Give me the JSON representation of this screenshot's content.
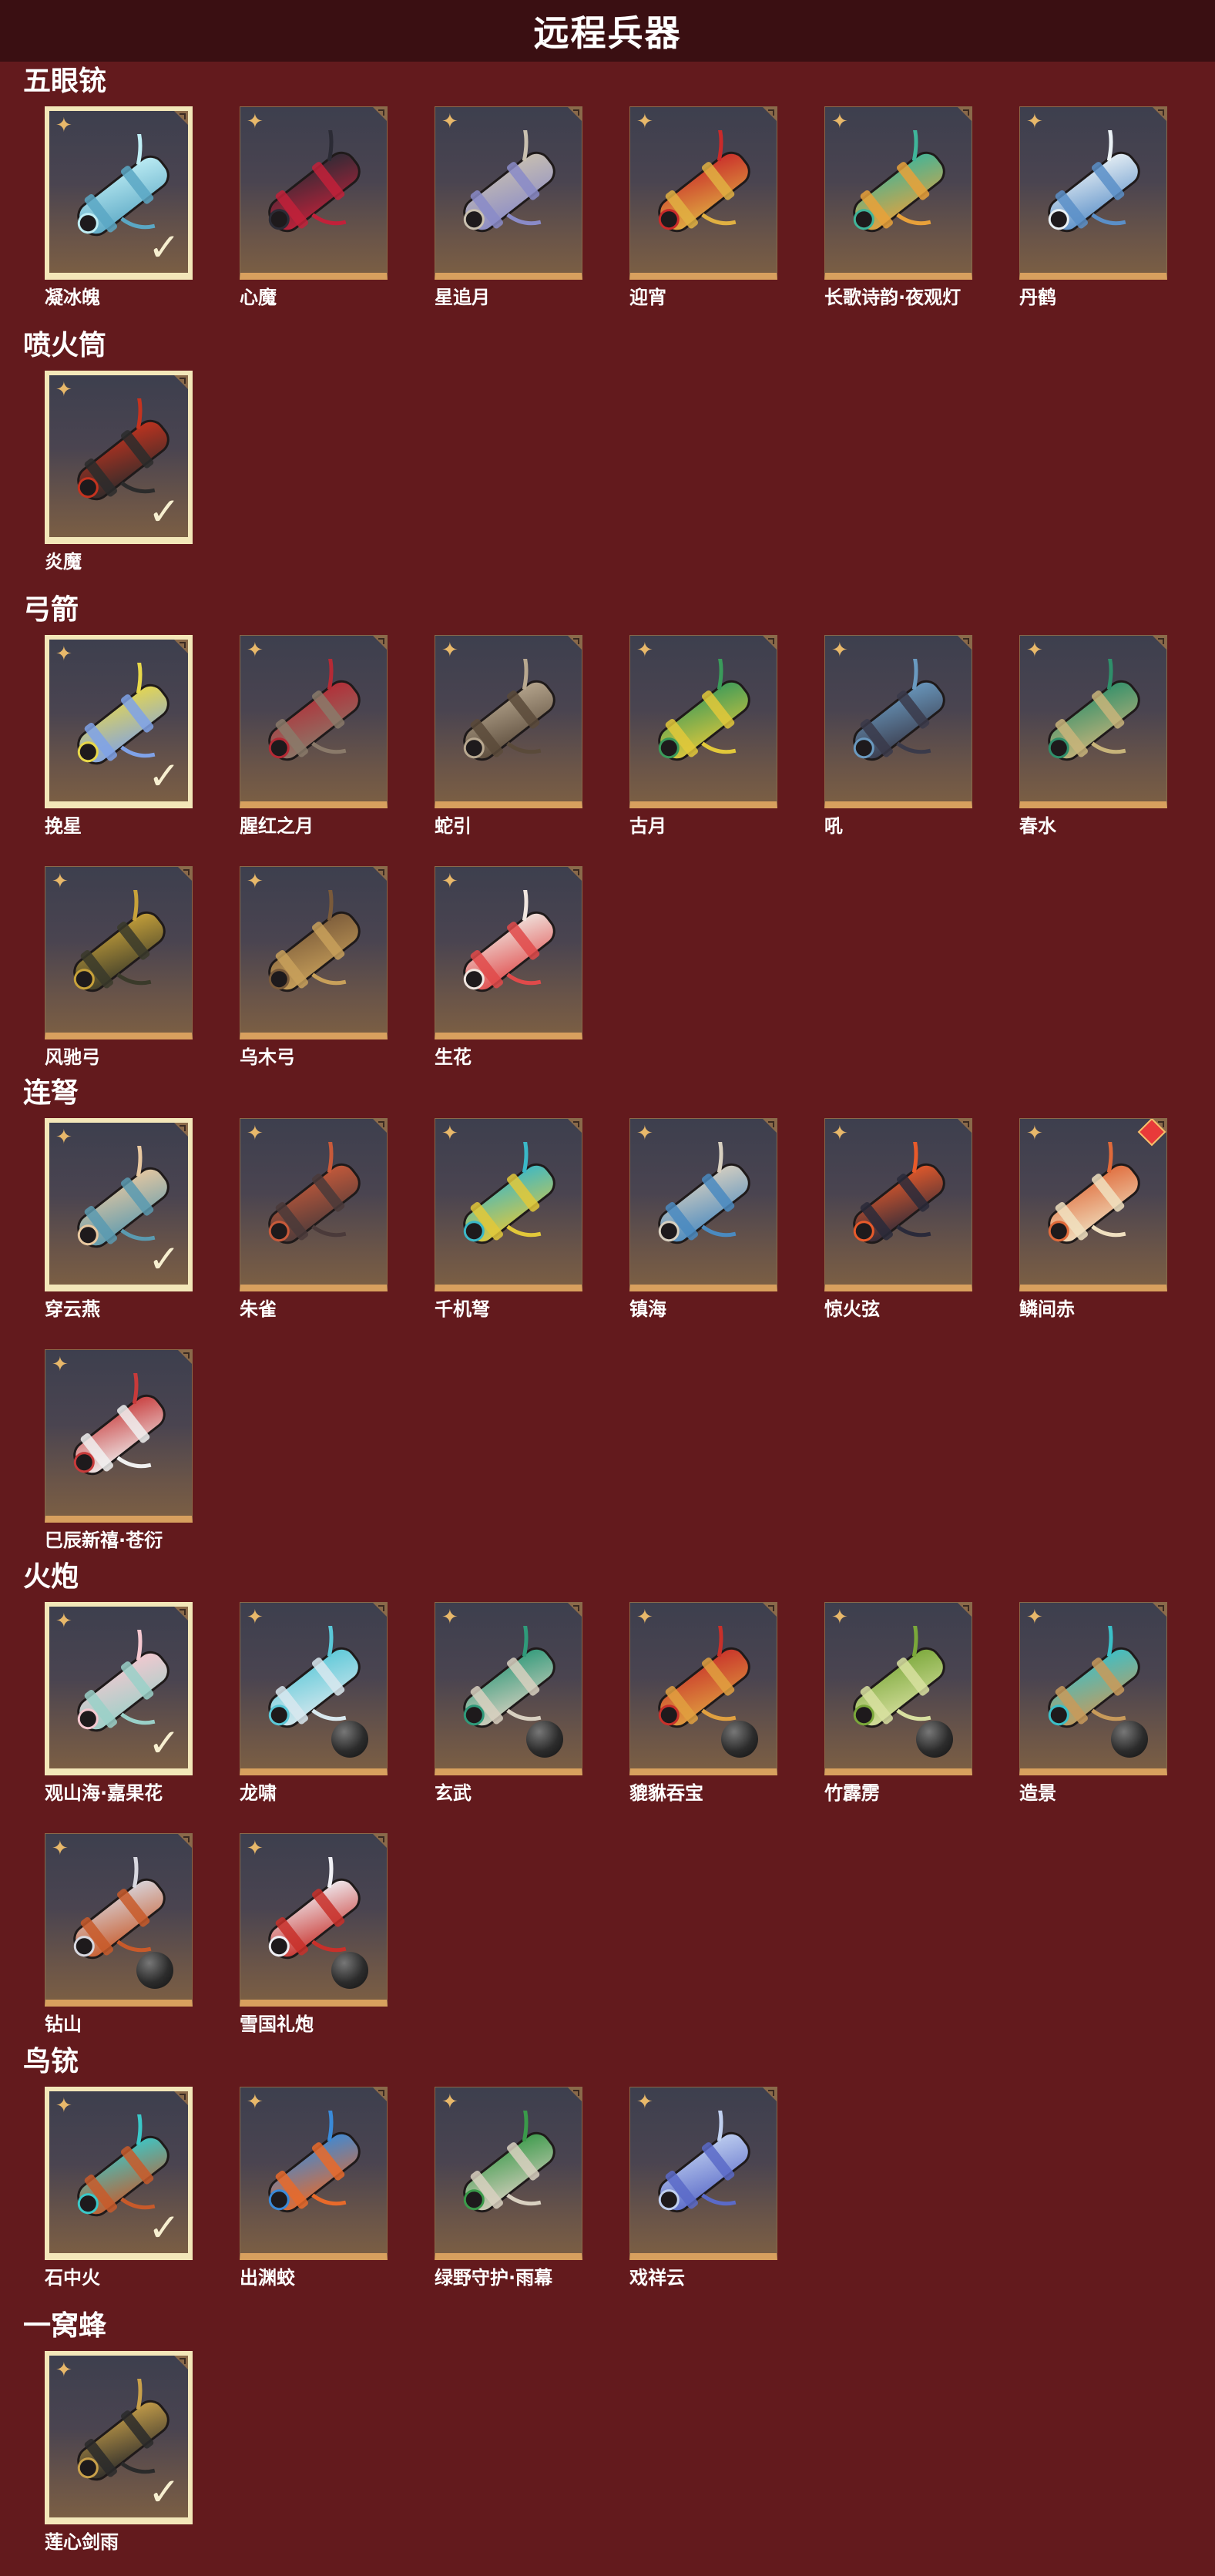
{
  "page": {
    "title": "远程兵器"
  },
  "colors": {
    "background": "#631a1d",
    "header": "#3a0f12",
    "card_bottom": "#d8a05e",
    "selected_border": "#f3e7b9"
  },
  "sections": [
    {
      "title": "五眼铳",
      "items": [
        {
          "name": "凝冰魄",
          "selected": true,
          "badge": "check",
          "palette": [
            "#bfeef5",
            "#5aa7c4"
          ]
        },
        {
          "name": "心魔",
          "selected": false,
          "badge": "none",
          "palette": [
            "#2b2b35",
            "#c2213a"
          ]
        },
        {
          "name": "星追月",
          "selected": false,
          "badge": "none",
          "palette": [
            "#c9c0b0",
            "#8a8bc8"
          ]
        },
        {
          "name": "迎宵",
          "selected": false,
          "badge": "none",
          "palette": [
            "#c92a2a",
            "#e0b042"
          ]
        },
        {
          "name": "长歌诗韵·夜观灯",
          "selected": false,
          "badge": "none",
          "palette": [
            "#3fb59a",
            "#e8a13a"
          ]
        },
        {
          "name": "丹鹤",
          "selected": false,
          "badge": "none",
          "palette": [
            "#eaf1f5",
            "#5a8fc8"
          ]
        }
      ]
    },
    {
      "title": "喷火筒",
      "items": [
        {
          "name": "炎魔",
          "selected": true,
          "badge": "check",
          "palette": [
            "#c4331f",
            "#2b2b2b"
          ]
        }
      ]
    },
    {
      "title": "弓箭",
      "items": [
        {
          "name": "挽星",
          "selected": true,
          "badge": "check",
          "palette": [
            "#e8d84a",
            "#7fa2e8"
          ]
        },
        {
          "name": "腥红之月",
          "selected": false,
          "badge": "none",
          "palette": [
            "#b52a35",
            "#8a7a6a"
          ]
        },
        {
          "name": "蛇引",
          "selected": false,
          "badge": "none",
          "palette": [
            "#b8a890",
            "#5a4a3a"
          ]
        },
        {
          "name": "古月",
          "selected": false,
          "badge": "none",
          "palette": [
            "#3a9a5a",
            "#e2c83a"
          ]
        },
        {
          "name": "吼",
          "selected": false,
          "badge": "none",
          "palette": [
            "#6a9ac0",
            "#3a3a4a"
          ]
        },
        {
          "name": "春水",
          "selected": false,
          "badge": "none",
          "palette": [
            "#2f8f6a",
            "#c8b47a"
          ]
        },
        {
          "name": "风驰弓",
          "selected": false,
          "badge": "none",
          "palette": [
            "#c8a23a",
            "#3a3a2a"
          ]
        },
        {
          "name": "乌木弓",
          "selected": false,
          "badge": "none",
          "palette": [
            "#7a5a3a",
            "#c8a05a"
          ]
        },
        {
          "name": "生花",
          "selected": false,
          "badge": "none",
          "palette": [
            "#f0e6e0",
            "#e04a4a"
          ]
        }
      ]
    },
    {
      "title": "连弩",
      "items": [
        {
          "name": "穿云燕",
          "selected": true,
          "badge": "check",
          "palette": [
            "#e8c8a0",
            "#5a9ab0"
          ]
        },
        {
          "name": "朱雀",
          "selected": false,
          "badge": "none",
          "palette": [
            "#c85a3a",
            "#4a3a3a"
          ]
        },
        {
          "name": "千机弩",
          "selected": false,
          "badge": "none",
          "palette": [
            "#3ab8c8",
            "#e2c83a"
          ]
        },
        {
          "name": "镇海",
          "selected": false,
          "badge": "none",
          "palette": [
            "#d8d0c0",
            "#4a8ac0"
          ]
        },
        {
          "name": "惊火弦",
          "selected": false,
          "badge": "none",
          "palette": [
            "#e85a2a",
            "#2a2a3a"
          ]
        },
        {
          "name": "鳞间赤",
          "selected": false,
          "badge": "gem",
          "palette": [
            "#e06a3a",
            "#f0e0c0"
          ]
        },
        {
          "name": "巳辰新禧·苍衍",
          "selected": false,
          "badge": "none",
          "palette": [
            "#c83a3a",
            "#f0f0f0"
          ]
        }
      ]
    },
    {
      "title": "火炮",
      "items": [
        {
          "name": "观山海·嘉果花",
          "selected": true,
          "badge": "check",
          "palette": [
            "#f5c8d0",
            "#9ad0c8"
          ]
        },
        {
          "name": "龙啸",
          "selected": false,
          "badge": "ball",
          "palette": [
            "#5ac8d8",
            "#d8e8ee"
          ]
        },
        {
          "name": "玄武",
          "selected": false,
          "badge": "ball",
          "palette": [
            "#2f9a7a",
            "#d8d0c0"
          ]
        },
        {
          "name": "貔貅吞宝",
          "selected": false,
          "badge": "ball",
          "palette": [
            "#c8302a",
            "#e0a040"
          ]
        },
        {
          "name": "竹霹雳",
          "selected": false,
          "badge": "ball",
          "palette": [
            "#7aa83a",
            "#d8e0a0"
          ]
        },
        {
          "name": "造景",
          "selected": false,
          "badge": "ball",
          "palette": [
            "#3ac0c8",
            "#c89a5a"
          ]
        },
        {
          "name": "钻山",
          "selected": false,
          "badge": "ball",
          "palette": [
            "#d8d8e0",
            "#c85a2a"
          ]
        },
        {
          "name": "雪国礼炮",
          "selected": false,
          "badge": "ball",
          "palette": [
            "#f0f0f5",
            "#c8302a"
          ]
        }
      ]
    },
    {
      "title": "鸟铳",
      "items": [
        {
          "name": "石中火",
          "selected": true,
          "badge": "check",
          "palette": [
            "#3ac8c8",
            "#c85a2a"
          ]
        },
        {
          "name": "出渊蛟",
          "selected": false,
          "badge": "none",
          "palette": [
            "#3a8ad8",
            "#e86a2a"
          ]
        },
        {
          "name": "绿野守护·雨幕",
          "selected": false,
          "badge": "none",
          "palette": [
            "#3a9a4a",
            "#d8d0c0"
          ]
        },
        {
          "name": "戏祥云",
          "selected": false,
          "badge": "none",
          "palette": [
            "#c0d0f0",
            "#5a6ac8"
          ]
        }
      ]
    },
    {
      "title": "一窝蜂",
      "items": [
        {
          "name": "莲心剑雨",
          "selected": true,
          "badge": "check",
          "palette": [
            "#c8a04a",
            "#2a2a2a"
          ]
        }
      ]
    }
  ]
}
